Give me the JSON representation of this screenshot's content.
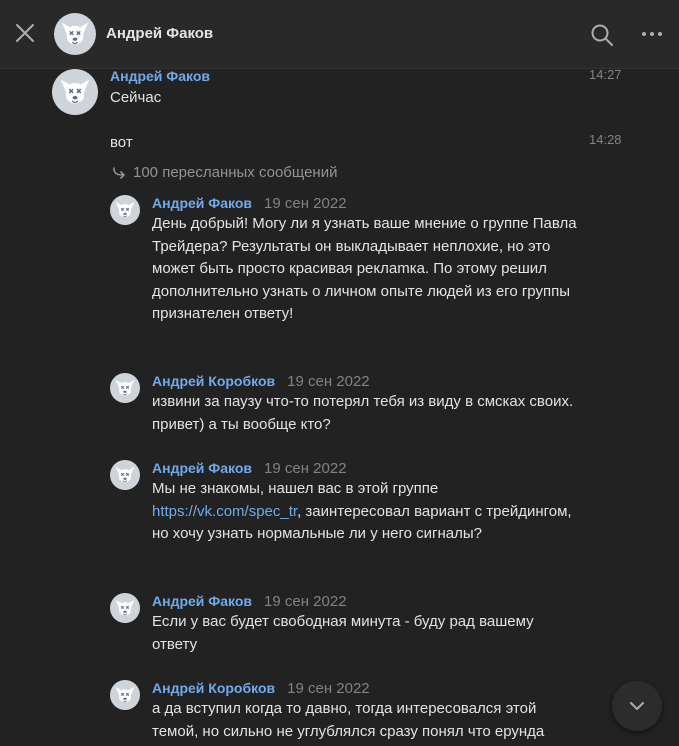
{
  "header": {
    "title": "Андрей Факов"
  },
  "messages": {
    "sender": "Андрей Факов",
    "first": {
      "time": "14:27",
      "text": "Сейчас"
    },
    "second": {
      "time": "14:28",
      "text": "вот"
    },
    "forwarded_label": "100 пересланных сообщений"
  },
  "forwarded": [
    {
      "name": "Андрей Факов",
      "date": "19 сен 2022",
      "text": "День добрый! Могу ли я узнать ваше мнение о группе Павла Трейдера? Результаты он выкладывает неплохие, но это может быть просто красивая реклamка. По этому решил дополнительно узнать о личном опыте людей из его группы признателен ответу!"
    },
    {
      "name": "Андрей Коробков",
      "date": "19 сен 2022",
      "text": "извини за паузу что-то потерял тебя из виду в смсках своих. привет) а ты вообще кто?"
    },
    {
      "name": "Андрей Факов",
      "date": "19 сен 2022",
      "text_before": "Мы не знакомы, нашел вас в этой группе",
      "link": "https://vk.com/spec_tr",
      "text_after": ", заинтересовал вариант с трейдингом, но хочу узнать нормальные ли у него сигналы?"
    },
    {
      "name": "Андрей Факов",
      "date": "19 сен 2022",
      "text": "Если у вас будет свободная минута - буду рад вашему ответу"
    },
    {
      "name": "Андрей Коробков",
      "date": "19 сен 2022",
      "text": "а да вступил когда то давно, тогда интересовался этой темой, но сильно не углублялся сразу понял что ерунда"
    }
  ],
  "icons": {
    "close": "close-icon",
    "search": "search-icon",
    "more": "more-icon",
    "forward": "forward-icon",
    "scroll_down": "chevron-down-icon",
    "avatar": "deactivated-dog-avatar"
  },
  "colors": {
    "background": "#222222",
    "header": "#292929",
    "accent": "#71aaeb",
    "text": "#e1e3e6",
    "muted": "#828282"
  }
}
